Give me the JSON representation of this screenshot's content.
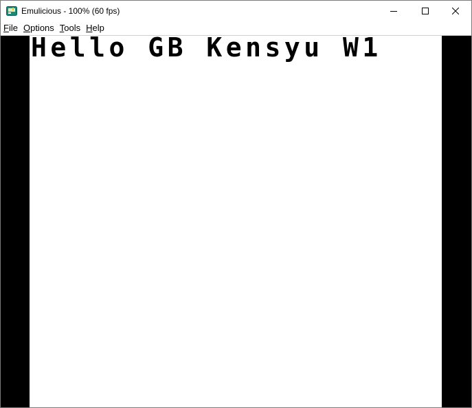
{
  "window": {
    "title": "Emulicious - 100% (60 fps)",
    "icon": "emulicious-app-icon"
  },
  "menubar": {
    "items": [
      {
        "accel": "F",
        "rest": "ile"
      },
      {
        "accel": "O",
        "rest": "ptions"
      },
      {
        "accel": "T",
        "rest": "ools"
      },
      {
        "accel": "H",
        "rest": "elp"
      }
    ]
  },
  "screen": {
    "text": "Hello GB Kensyu W1"
  },
  "colors": {
    "titlebar_bg": "#ffffff",
    "viewport_border": "#000000",
    "screen_bg": "#ffffff",
    "screen_text": "#000000",
    "app_icon_green": "#1a8a7a"
  }
}
